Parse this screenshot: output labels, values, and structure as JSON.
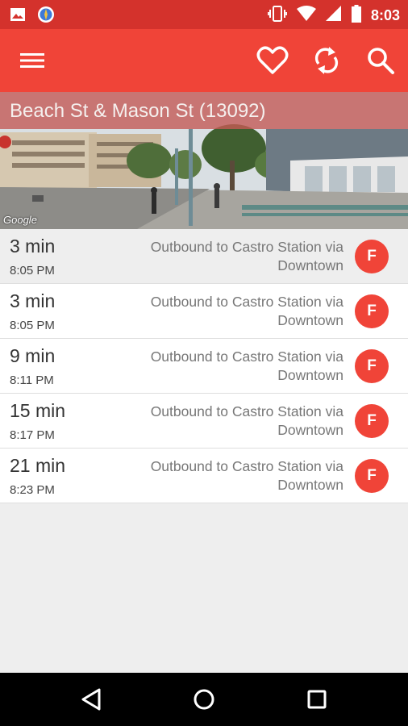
{
  "status_bar": {
    "time": "8:03",
    "icons": [
      "gallery-icon",
      "compass-icon",
      "vibrate-icon",
      "wifi-icon",
      "signal-icon",
      "battery-icon"
    ]
  },
  "app_bar": {
    "icons": [
      "menu-icon",
      "heart-icon",
      "refresh-icon",
      "search-icon"
    ],
    "color": "#f04438"
  },
  "stop": {
    "title": "Beach St & Mason St (13092)",
    "image_attribution": "Google"
  },
  "arrivals": [
    {
      "minutes": "3 min",
      "time": "8:05 PM",
      "destination": "Outbound to Castro Station via Downtown",
      "route": "F"
    },
    {
      "minutes": "3 min",
      "time": "8:05 PM",
      "destination": "Outbound to Castro Station via Downtown",
      "route": "F"
    },
    {
      "minutes": "9 min",
      "time": "8:11 PM",
      "destination": "Outbound to Castro Station via Downtown",
      "route": "F"
    },
    {
      "minutes": "15 min",
      "time": "8:17 PM",
      "destination": "Outbound to Castro Station via Downtown",
      "route": "F"
    },
    {
      "minutes": "21 min",
      "time": "8:23 PM",
      "destination": "Outbound to Castro Station via Downtown",
      "route": "F"
    }
  ],
  "nav_bar": {
    "icons": [
      "back-icon",
      "home-icon",
      "recents-icon"
    ]
  }
}
